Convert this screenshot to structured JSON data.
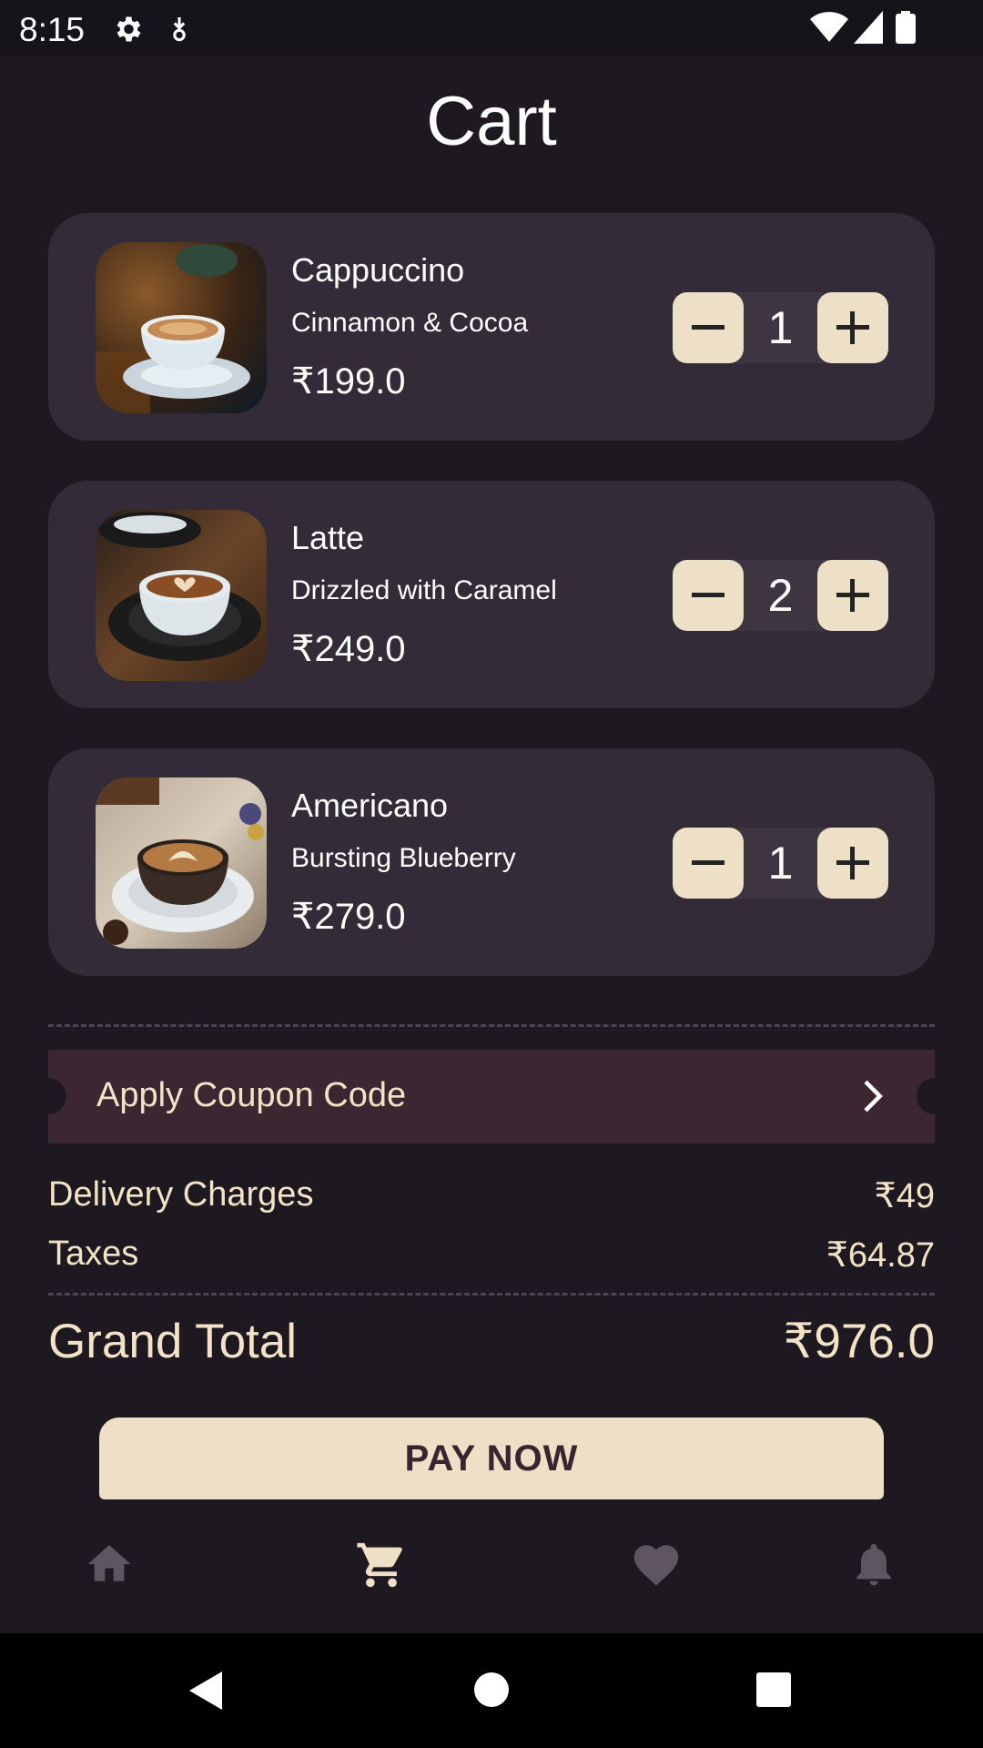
{
  "status_bar": {
    "time": "8:15",
    "icons": [
      "settings-icon",
      "download-icon",
      "wifi-icon",
      "signal-icon",
      "battery-icon"
    ]
  },
  "header": {
    "title": "Cart"
  },
  "cart": {
    "items": [
      {
        "name": "Cappuccino",
        "description": "Cinnamon & Cocoa",
        "price": "₹199.0",
        "quantity": "1"
      },
      {
        "name": "Latte",
        "description": "Drizzled with Caramel",
        "price": "₹249.0",
        "quantity": "2"
      },
      {
        "name": "Americano",
        "description": "Bursting Blueberry",
        "price": "₹279.0",
        "quantity": "1"
      }
    ]
  },
  "coupon": {
    "label": "Apply Coupon Code"
  },
  "summary": {
    "delivery_label": "Delivery Charges",
    "delivery_value": "₹49",
    "taxes_label": "Taxes",
    "taxes_value": "₹64.87",
    "grand_total_label": "Grand Total",
    "grand_total_value": "₹976.0"
  },
  "pay_button": {
    "label": "PAY NOW"
  },
  "bottom_nav": {
    "items": [
      {
        "icon": "home-icon",
        "active": false
      },
      {
        "icon": "cart-icon",
        "active": true
      },
      {
        "icon": "heart-icon",
        "active": false
      },
      {
        "icon": "bell-icon",
        "active": false
      }
    ]
  },
  "colors": {
    "background": "#1e1820",
    "card": "#332b37",
    "accent_cream": "#ede0c6",
    "coupon_bg": "#3b2631",
    "text_cream": "#f2e3c6"
  }
}
